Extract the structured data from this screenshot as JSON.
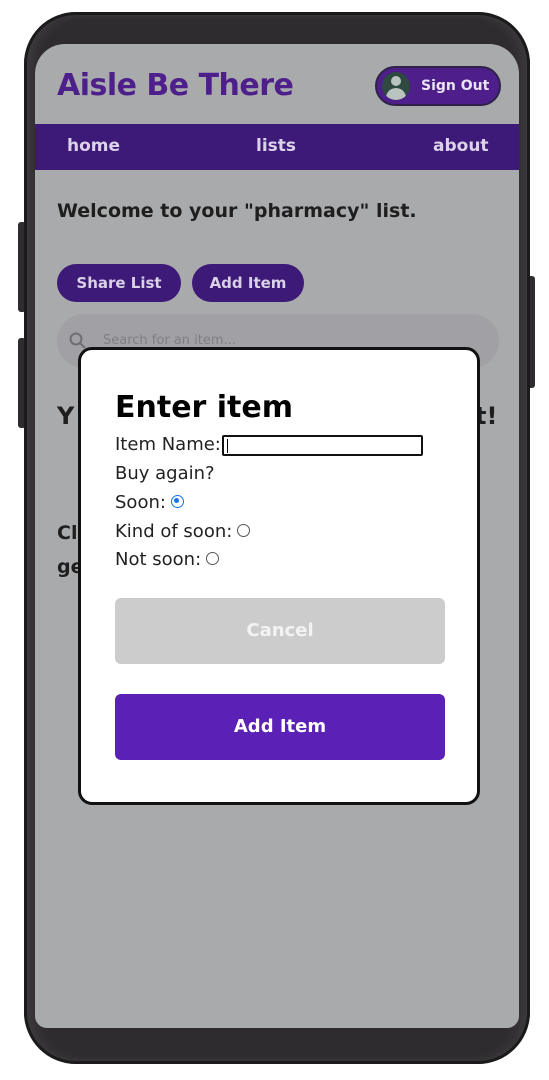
{
  "app": {
    "title": "Aisle Be There",
    "sign_out_label": "Sign Out"
  },
  "nav": {
    "items": [
      {
        "label": "home"
      },
      {
        "label": "lists"
      },
      {
        "label": "about"
      }
    ]
  },
  "list_page": {
    "welcome": "Welcome to your \"pharmacy\" list.",
    "share_button": "Share List",
    "add_button": "Add Item",
    "search_placeholder": "Search for an item...",
    "bg_heading_left": "Y",
    "bg_heading_right": "t!",
    "bg_text_1": "Cl",
    "bg_text_2": "ge"
  },
  "modal": {
    "title": "Enter item",
    "item_name_label": "Item Name:",
    "item_name_value": "",
    "buy_again_label": "Buy again?",
    "options": [
      {
        "label": "Soon:",
        "selected": true
      },
      {
        "label": "Kind of soon:",
        "selected": false
      },
      {
        "label": "Not soon:",
        "selected": false
      }
    ],
    "cancel_label": "Cancel",
    "submit_label": "Add Item"
  },
  "colors": {
    "brand_purple": "#4e1f8a",
    "nav_bg": "#3e1a78",
    "add_button": "#5b21b6",
    "overlay_grey": "#a9aaac",
    "radio_selected": "#1a73e8"
  }
}
